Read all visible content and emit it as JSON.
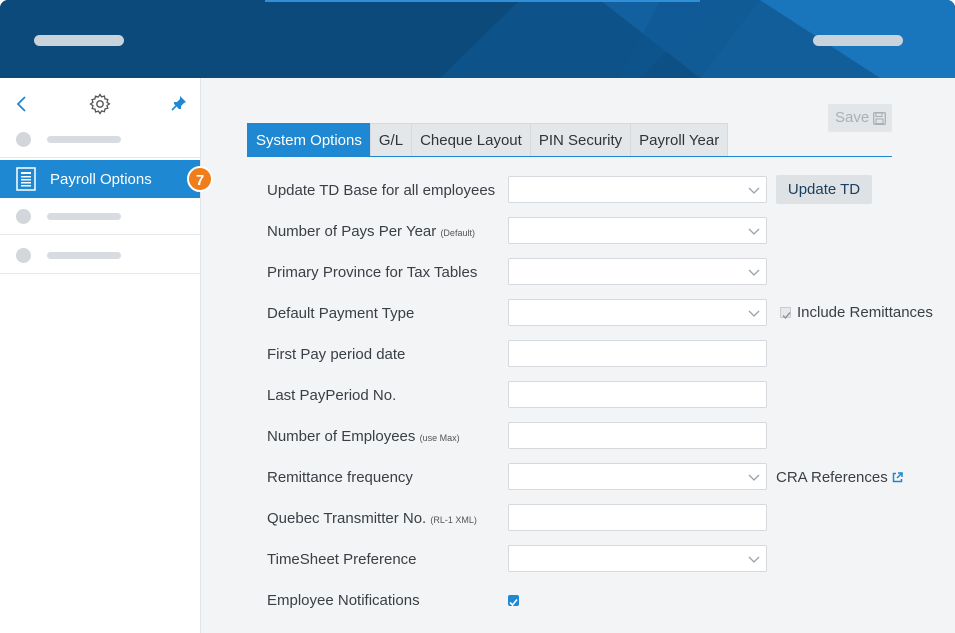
{
  "colors": {
    "accent": "#1e88d2",
    "header": "#0b4a7a",
    "badge": "#ef7d1a"
  },
  "header": {
    "left_placeholder": "",
    "right_placeholder": ""
  },
  "sidebar": {
    "icons": [
      "back-chevron-icon",
      "gear-icon",
      "pin-icon"
    ],
    "active_item": {
      "label": "Payroll Options",
      "icon": "document-list-icon"
    },
    "badge": "7"
  },
  "toolbar": {
    "save_label": "Save",
    "save_icon": "floppy-disk-icon"
  },
  "tabs": [
    {
      "label": "System Options",
      "active": true
    },
    {
      "label": "G/L",
      "active": false
    },
    {
      "label": "Cheque Layout",
      "active": false
    },
    {
      "label": "PIN Security",
      "active": false
    },
    {
      "label": "Payroll Year",
      "active": false
    }
  ],
  "form": {
    "fields": [
      {
        "label": "Update TD Base for all employees",
        "note": "",
        "type": "select",
        "value": ""
      },
      {
        "label": "Number of Pays Per Year",
        "note": "(Default)",
        "type": "select",
        "value": ""
      },
      {
        "label": "Primary Province for Tax Tables",
        "note": "",
        "type": "select",
        "value": ""
      },
      {
        "label": "Default Payment Type",
        "note": "",
        "type": "select",
        "value": ""
      },
      {
        "label": "First Pay period date",
        "note": "",
        "type": "text",
        "value": ""
      },
      {
        "label": "Last PayPeriod No.",
        "note": "",
        "type": "text",
        "value": ""
      },
      {
        "label": "Number of Employees",
        "note": "(use Max)",
        "type": "text",
        "value": ""
      },
      {
        "label": "Remittance frequency",
        "note": "",
        "type": "select",
        "value": ""
      },
      {
        "label": "Quebec Transmitter No.",
        "note": "(RL-1 XML)",
        "type": "text",
        "value": ""
      },
      {
        "label": "TimeSheet Preference",
        "note": "",
        "type": "select",
        "value": ""
      },
      {
        "label": "Employee Notifications",
        "note": "",
        "type": "checkbox",
        "checked": true
      }
    ],
    "update_td_label": "Update TD",
    "include_remittances_label": "Include Remittances",
    "include_remittances_checked": true,
    "cra_references_label": "CRA References",
    "cra_icon": "external-link-icon"
  }
}
